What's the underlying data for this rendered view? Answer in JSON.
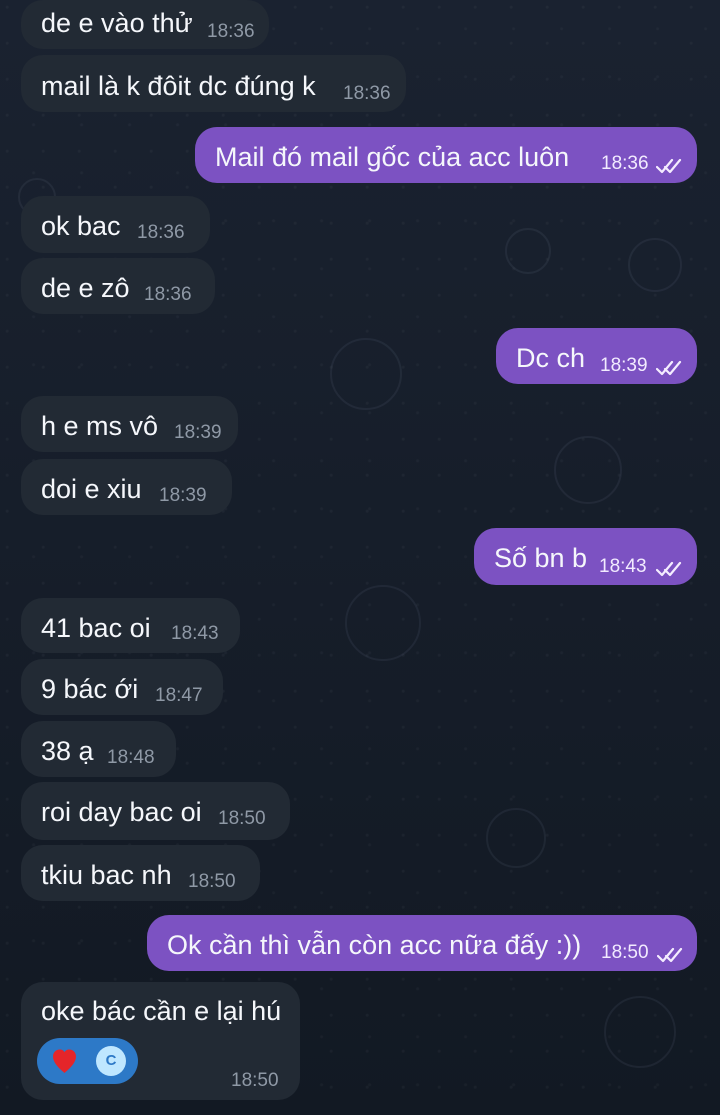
{
  "messages": [
    {
      "text": "de e vào thử",
      "time": "18:36"
    },
    {
      "text": "mail là k đôit dc đúng k",
      "time": "18:36"
    },
    {
      "text": "Mail đó mail gốc của acc luôn",
      "time": "18:36"
    },
    {
      "text": "ok bac",
      "time": "18:36"
    },
    {
      "text": "de e zô",
      "time": "18:36"
    },
    {
      "text": "Dc ch",
      "time": "18:39"
    },
    {
      "text": "h e ms vô",
      "time": "18:39"
    },
    {
      "text": "doi e xiu",
      "time": "18:39"
    },
    {
      "text": "Số bn b",
      "time": "18:43"
    },
    {
      "text": "41 bac oi",
      "time": "18:43"
    },
    {
      "text": "9 bác ới",
      "time": "18:47"
    },
    {
      "text": "38 ạ",
      "time": "18:48"
    },
    {
      "text": "roi day bac oi",
      "time": "18:50"
    },
    {
      "text": "tkiu bac nh",
      "time": "18:50"
    },
    {
      "text": "Ok cần thì vẫn còn acc nữa đấy :))",
      "time": "18:50"
    },
    {
      "text": "oke bác cần e lại hú",
      "time": "18:50"
    }
  ],
  "reaction": {
    "icon": "heart-icon",
    "avatar_letter": "C"
  },
  "colors": {
    "background": "#151c26",
    "incoming_bubble": "#222a34",
    "outgoing_bubble": "#7c52c2",
    "reaction_pill": "#2d79c7",
    "heart": "#e5252a"
  }
}
